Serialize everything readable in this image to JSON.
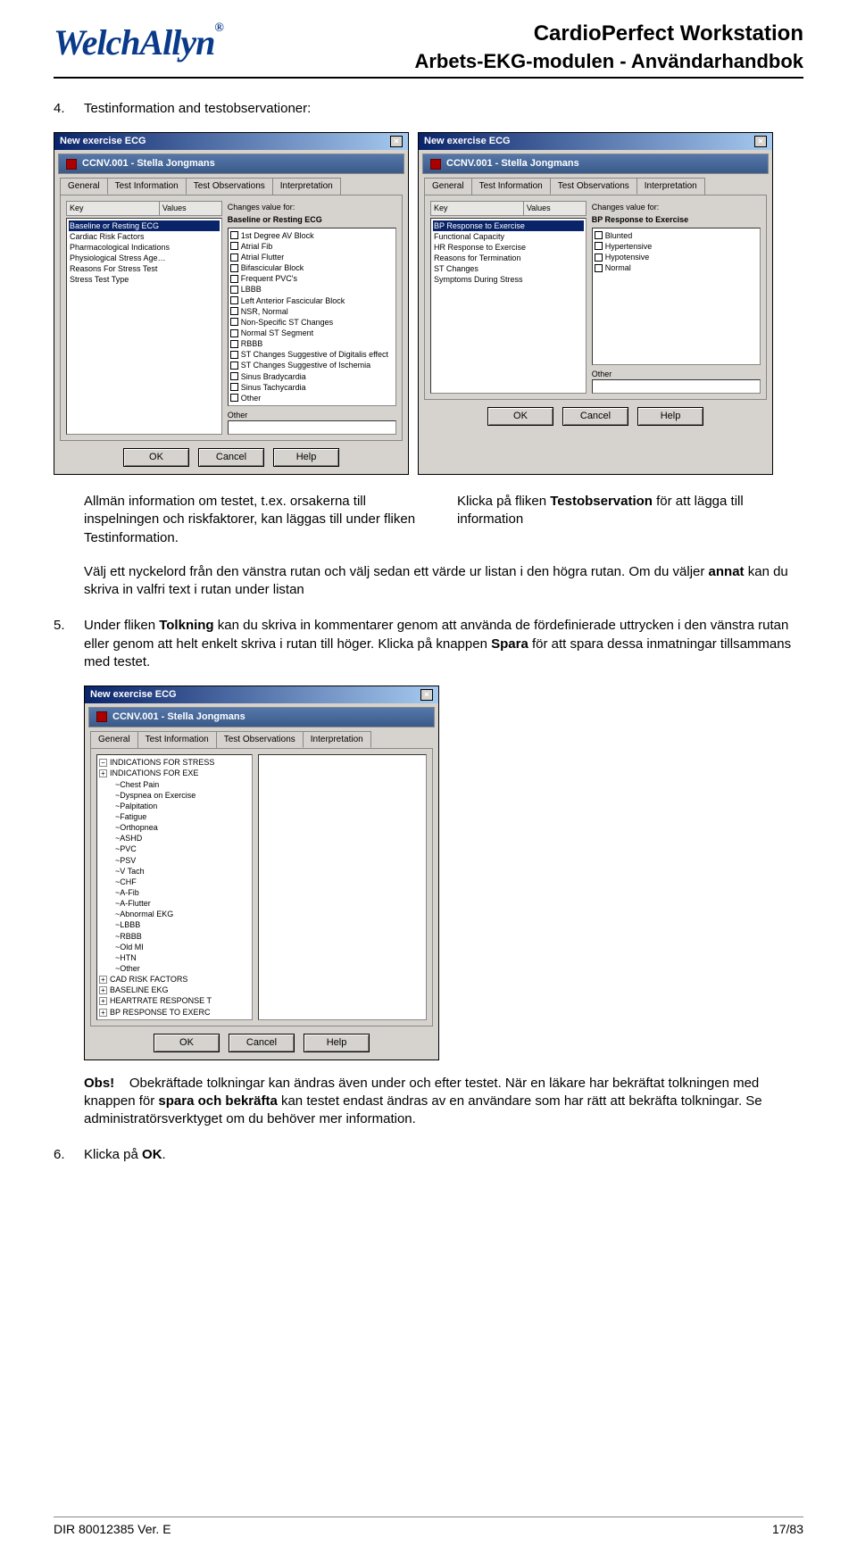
{
  "header": {
    "logo_text": "WelchAllyn",
    "title1": "CardioPerfect Workstation",
    "title2": "Arbets-EKG-modulen - Användarhandbok"
  },
  "section4": {
    "num": "4.",
    "title": "Testinformation and testobservationer:"
  },
  "dialog_left": {
    "window_title": "New exercise ECG",
    "subtitle": "CCNV.001 - Stella Jongmans",
    "tabs": [
      "General",
      "Test Information",
      "Test Observations",
      "Interpretation"
    ],
    "selected_tab_index": 1,
    "key_header": "Key",
    "values_header": "Values",
    "keys": [
      "Baseline or Resting ECG",
      "Cardiac Risk Factors",
      "Pharmacological Indications",
      "Physiological Stress Age…",
      "Reasons For Stress Test",
      "Stress Test Type"
    ],
    "selected_key_index": 0,
    "changes_label": "Changes value for:",
    "changes_value": "Baseline or Resting ECG",
    "checks": [
      "1st Degree AV Block",
      "Atrial Fib",
      "Atrial Flutter",
      "Bifascicular Block",
      "Frequent PVC's",
      "LBBB",
      "Left Anterior Fascicular Block",
      "NSR, Normal",
      "Non-Specific ST Changes",
      "Normal ST Segment",
      "RBBB",
      "ST Changes Suggestive of Digitalis effect",
      "ST Changes Suggestive of Ischemia",
      "Sinus Bradycardia",
      "Sinus Tachycardia",
      "Other"
    ],
    "other_label": "Other",
    "buttons": {
      "ok": "OK",
      "cancel": "Cancel",
      "help": "Help"
    }
  },
  "dialog_right": {
    "window_title": "New exercise ECG",
    "subtitle": "CCNV.001 - Stella Jongmans",
    "tabs": [
      "General",
      "Test Information",
      "Test Observations",
      "Interpretation"
    ],
    "selected_tab_index": 2,
    "key_header": "Key",
    "values_header": "Values",
    "keys": [
      "BP Response to Exercise",
      "Functional Capacity",
      "HR Response to Exercise",
      "Reasons for Termination",
      "ST Changes",
      "Symptoms During Stress"
    ],
    "selected_key_index": 0,
    "changes_label": "Changes value for:",
    "changes_value": "BP Response to Exercise",
    "checks": [
      "Blunted",
      "Hypertensive",
      "Hypotensive",
      "Normal"
    ],
    "other_label": "Other",
    "buttons": {
      "ok": "OK",
      "cancel": "Cancel",
      "help": "Help"
    }
  },
  "caption_left": "Allmän information om testet, t.ex. orsakerna till inspelningen och riskfaktorer, kan läggas till under fliken Testinformation.",
  "caption_right_pre": "Klicka på fliken ",
  "caption_right_bold": "Testobservation",
  "caption_right_post": " för att lägga till information",
  "para4b_pre": "Välj ett nyckelord från den vänstra rutan och välj sedan ett värde ur listan i den högra rutan. Om du väljer ",
  "para4b_bold": "annat",
  "para4b_post": " kan du skriva in valfri text i rutan under listan",
  "section5": {
    "num": "5.",
    "text_pre": "Under fliken ",
    "text_b1": "Tolkning",
    "text_mid": " kan du skriva in kommentarer genom att använda de fördefinierade uttrycken i den vänstra rutan eller genom att helt enkelt skriva i rutan till höger. Klicka på knappen ",
    "text_b2": "Spara",
    "text_post": " för att spara dessa inmatningar tillsammans med testet."
  },
  "dialog_interp": {
    "window_title": "New exercise ECG",
    "subtitle": "CCNV.001 - Stella Jongmans",
    "tabs": [
      "General",
      "Test Information",
      "Test Observations",
      "Interpretation"
    ],
    "selected_tab_index": 3,
    "tree": [
      {
        "pm": "-",
        "label": "INDICATIONS FOR STRESS"
      },
      {
        "pm": "+",
        "label": "INDICATIONS FOR EXE"
      },
      {
        "child": "~Chest Pain"
      },
      {
        "child": "~Dyspnea on Exercise"
      },
      {
        "child": "~Palpitation"
      },
      {
        "child": "~Fatigue"
      },
      {
        "child": "~Orthopnea"
      },
      {
        "child": "~ASHD"
      },
      {
        "child": "~PVC"
      },
      {
        "child": "~PSV"
      },
      {
        "child": "~V Tach"
      },
      {
        "child": "~CHF"
      },
      {
        "child": "~A-Fib"
      },
      {
        "child": "~A-Flutter"
      },
      {
        "child": "~Abnormal EKG"
      },
      {
        "child": "~LBBB"
      },
      {
        "child": "~RBBB"
      },
      {
        "child": "~Old MI"
      },
      {
        "child": "~HTN"
      },
      {
        "child": "~Other"
      },
      {
        "pm": "+",
        "label": "CAD RISK FACTORS"
      },
      {
        "pm": "+",
        "label": "BASELINE EKG"
      },
      {
        "pm": "+",
        "label": "HEARTRATE RESPONSE T"
      },
      {
        "pm": "+",
        "label": "BP RESPONSE TO EXERC"
      }
    ],
    "buttons": {
      "ok": "OK",
      "cancel": "Cancel",
      "help": "Help"
    }
  },
  "obs": {
    "label": "Obs!",
    "text_pre": "Obekräftade tolkningar kan ändras även under och efter testet. När en läkare har bekräftat tolkningen med knappen för ",
    "text_bold": "spara och bekräfta",
    "text_post": " kan testet endast ändras av en användare som har rätt att bekräfta tolkningar. Se administratörsverktyget om du behöver mer information."
  },
  "section6": {
    "num": "6.",
    "text_pre": "Klicka på ",
    "text_bold": "OK",
    "text_post": "."
  },
  "footer": {
    "left": "DIR 80012385 Ver. E",
    "right": "17/83"
  }
}
